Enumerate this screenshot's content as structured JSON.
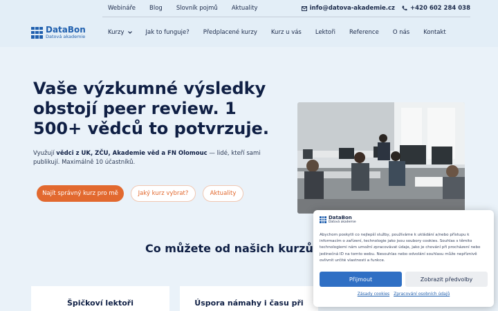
{
  "topbar": {
    "links": [
      "Webináře",
      "Blog",
      "Slovník pojmů",
      "Aktuality"
    ],
    "email": "info@datova-akademie.cz",
    "phone": "+420 602 284 038"
  },
  "logo": {
    "brand": "DataBon",
    "sub": "Datová akademie"
  },
  "menu": {
    "items": [
      "Kurzy",
      "Jak to funguje?",
      "Předplacené kurzy",
      "Kurz u vás",
      "Lektoři",
      "Reference",
      "O nás",
      "Kontakt"
    ]
  },
  "hero": {
    "headline": "Vaše výzkumné výsledky obstojí peer review. 1 500+ vědců to potvrzuje.",
    "lead_pre": "Využují ",
    "lead_bold": "vědci z UK, ZČU, Akademie věd a FN Olomouc",
    "lead_post": " — lidé, kteří sami publikují. Maximálně 10 účastníků.",
    "btn_primary": "Najít správný kurz pro mě",
    "btn_secondary": "Jaký kurz vybrat?",
    "btn_news": "Aktuality"
  },
  "section": {
    "title": "Co můžete od našich kurzů oč",
    "cards": [
      "Špičkoví lektoři",
      "Úspora námahy i času při"
    ]
  },
  "cookie": {
    "brand": "DataBon",
    "sub": "Datová akademie",
    "text": "Abychom poskytli co nejlepší služby, používáme k ukládání a/nebo přístupu k informacím o zařízení, technologie jako jsou soubory cookies. Souhlas s těmito technologiemi nám umožní zpracovávat údaje, jako je chování při procházení nebo jedinečná ID na tomto webu. Nesouhlas nebo odvolání souhlasu může nepříznivě ovlivnit určité vlastnosti a funkce.",
    "accept": "Přijmout",
    "preferences": "Zobrazit předvolby",
    "link_cookies": "Zásady cookies",
    "link_privacy": "Zpracování osobních údajů"
  },
  "colors": {
    "accent": "#e2692f",
    "brand": "#1f5fae",
    "background": "#eaf2f9"
  }
}
